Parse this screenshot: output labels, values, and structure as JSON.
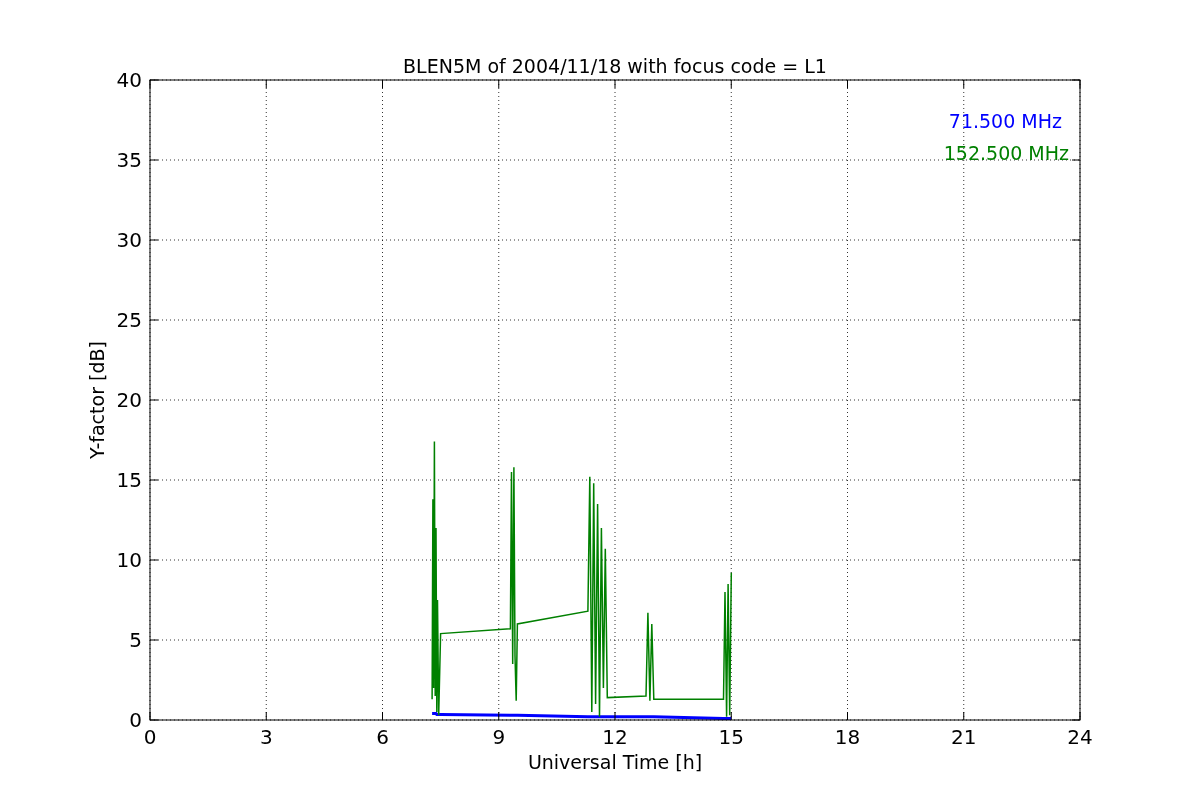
{
  "chart": {
    "chart_data": {
      "type": "line",
      "title": "BLEN5M of 2004/11/18 with focus code = L1",
      "xlabel": "Universal Time [h]",
      "ylabel": "Y-factor [dB]",
      "x": [
        7.28,
        7.3,
        7.32,
        7.34,
        7.36,
        7.38,
        7.4,
        7.42,
        7.45,
        7.5,
        9.3,
        9.33,
        9.36,
        9.39,
        9.42,
        9.45,
        9.48,
        11.3,
        11.35,
        11.4,
        11.45,
        11.5,
        11.55,
        11.6,
        11.65,
        11.7,
        11.75,
        11.8,
        12.8,
        12.85,
        12.9,
        12.95,
        13.0,
        14.8,
        14.84,
        14.88,
        14.92,
        14.96,
        15.0
      ],
      "series": [
        {
          "name": "71.500 MHz",
          "color": "#0000ff",
          "values": [
            0.4,
            0.4,
            0.4,
            0.4,
            0.4,
            0.4,
            0.35,
            0.35,
            0.35,
            0.35,
            0.3,
            0.3,
            0.3,
            0.3,
            0.3,
            0.3,
            0.3,
            0.2,
            0.2,
            0.2,
            0.2,
            0.2,
            0.2,
            0.2,
            0.2,
            0.2,
            0.2,
            0.2,
            0.2,
            0.2,
            0.2,
            0.2,
            0.2,
            0.1,
            0.1,
            0.1,
            0.1,
            0.1,
            0.1
          ]
        },
        {
          "name": "152.500 MHz",
          "color": "#008000",
          "values": [
            1.3,
            13.8,
            2.0,
            17.4,
            1.5,
            12.0,
            0.5,
            7.5,
            0.3,
            5.4,
            5.7,
            15.5,
            3.5,
            15.8,
            4.0,
            1.2,
            6.0,
            6.8,
            15.2,
            0.5,
            14.8,
            1.0,
            13.5,
            0.2,
            12.0,
            2.0,
            10.7,
            1.4,
            1.5,
            6.7,
            1.2,
            6.0,
            1.3,
            1.3,
            8.0,
            0.2,
            8.5,
            0.3,
            9.2
          ]
        }
      ],
      "grid": true,
      "xlim": [
        0,
        24
      ],
      "ylim": [
        0,
        40
      ],
      "xticks": [
        0,
        3,
        6,
        9,
        12,
        15,
        18,
        21,
        24
      ],
      "yticks": [
        0,
        5,
        10,
        15,
        20,
        25,
        30,
        35,
        40
      ]
    }
  }
}
